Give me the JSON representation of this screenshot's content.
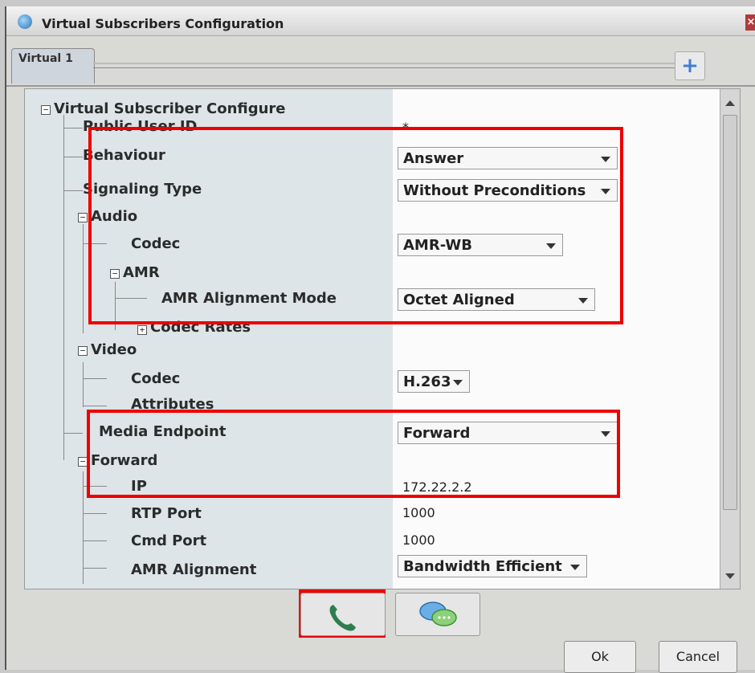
{
  "window": {
    "title": "Virtual Subscribers Configuration"
  },
  "tabs": [
    {
      "label": "Virtual 1"
    }
  ],
  "tree": {
    "root_label": "Virtual Subscriber Configure",
    "public_user_id": {
      "label": "Public User ID",
      "value": "*"
    },
    "behaviour": {
      "label": "Behaviour",
      "value": "Answer"
    },
    "signaling_type": {
      "label": "Signaling Type",
      "value": "Without Preconditions"
    },
    "audio": {
      "label": "Audio",
      "codec": {
        "label": "Codec",
        "value": "AMR-WB"
      },
      "amr": {
        "label": "AMR",
        "alignment_mode": {
          "label": "AMR Alignment Mode",
          "value": "Octet Aligned"
        },
        "codec_rates": {
          "label": "Codec Rates"
        }
      }
    },
    "video": {
      "label": "Video",
      "codec": {
        "label": "Codec",
        "value": "H.263"
      },
      "attributes": {
        "label": "Attributes"
      }
    },
    "media_endpoint": {
      "label": "Media Endpoint",
      "value": "Forward"
    },
    "forward": {
      "label": "Forward",
      "ip": {
        "label": "IP",
        "value": "172.22.2.2"
      },
      "rtp_port": {
        "label": "RTP Port",
        "value": "1000"
      },
      "cmd_port": {
        "label": "Cmd Port",
        "value": "1000"
      },
      "amr_alignment": {
        "label": "AMR Alignment",
        "value": "Bandwidth Efficient"
      }
    }
  },
  "buttons": {
    "ok": "Ok",
    "cancel": "Cancel"
  },
  "icons": {
    "add": "plus-icon",
    "call": "phone-icon",
    "chat": "chat-bubbles-icon",
    "close": "close-icon"
  },
  "colors": {
    "highlight": "#ee0000",
    "accent": "#3d7fd0",
    "phone": "#2e7d4f"
  }
}
